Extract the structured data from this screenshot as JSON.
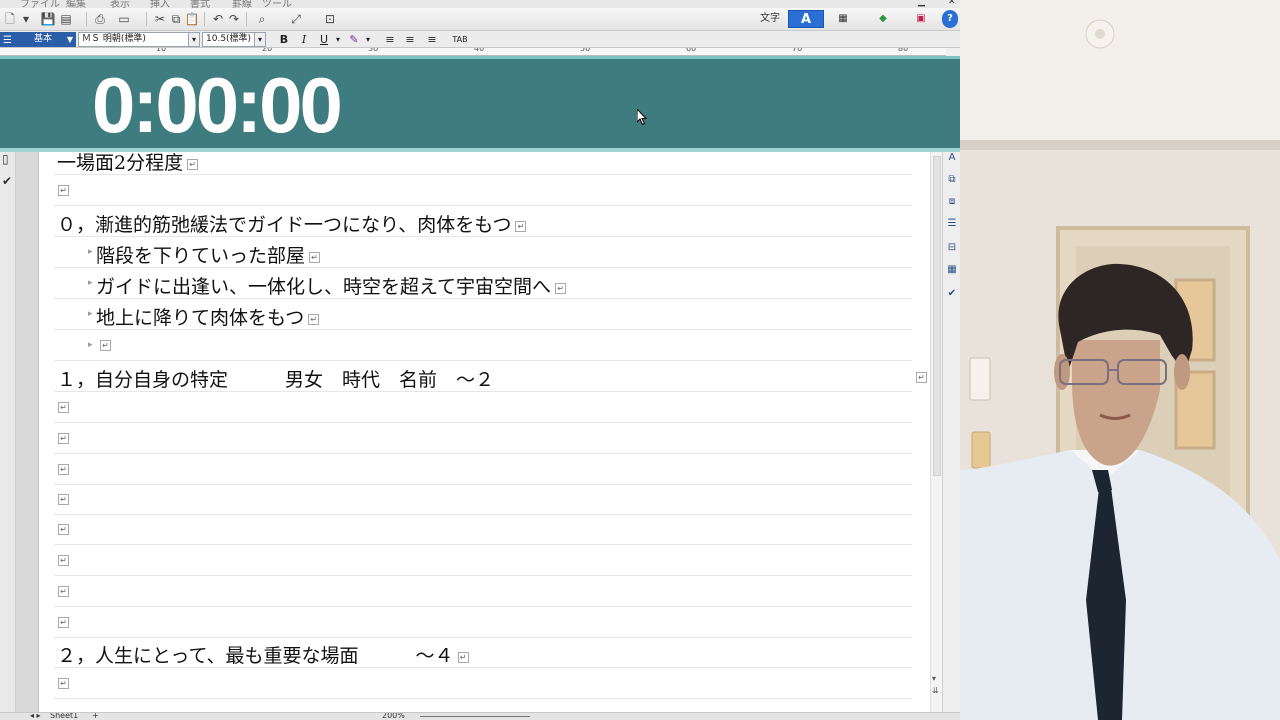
{
  "toolbar": {
    "mode_label": "文字",
    "mode_a": "A",
    "help": "?"
  },
  "format_bar": {
    "style": "基本",
    "font": "ＭＳ 明朝(標準)",
    "size": "10.5(標準)",
    "bold": "B",
    "italic": "I",
    "underline": "U",
    "tab": "TAB"
  },
  "ruler_ticks": [
    "10",
    "20",
    "30",
    "40",
    "50",
    "60",
    "70",
    "80"
  ],
  "timer": {
    "value": "0:00:00"
  },
  "document": {
    "lines": [
      {
        "text": "一場面2分程度",
        "indent": false
      },
      {
        "text": "",
        "indent": false
      },
      {
        "text": "０，漸進的筋弛緩法でガイド一つになり、肉体をもつ",
        "indent": false
      },
      {
        "text": "階段を下りていった部屋",
        "indent": true
      },
      {
        "text": "ガイドに出逢い、一体化し、時空を超えて宇宙空間へ",
        "indent": true
      },
      {
        "text": "地上に降りて肉体をもつ",
        "indent": true
      },
      {
        "text": "",
        "indent": true
      },
      {
        "text": "１，自分自身の特定　　　男女　時代　名前　～２",
        "indent": false
      },
      {
        "text": "",
        "indent": false
      },
      {
        "text": "",
        "indent": false
      },
      {
        "text": "",
        "indent": false
      },
      {
        "text": "",
        "indent": false
      },
      {
        "text": "",
        "indent": false
      },
      {
        "text": "",
        "indent": false
      },
      {
        "text": "",
        "indent": false
      },
      {
        "text": "",
        "indent": false
      },
      {
        "text": "２，人生にとって、最も重要な場面　　　～４",
        "indent": false
      },
      {
        "text": "",
        "indent": false
      }
    ]
  },
  "status": {
    "sheet": "Sheet1",
    "zoom": "200%"
  },
  "colors": {
    "timer_bg": "#3f7c80",
    "timer_border": "#9fd2d3",
    "style_box": "#2b5ea8",
    "mode_active": "#2a6fd6"
  }
}
